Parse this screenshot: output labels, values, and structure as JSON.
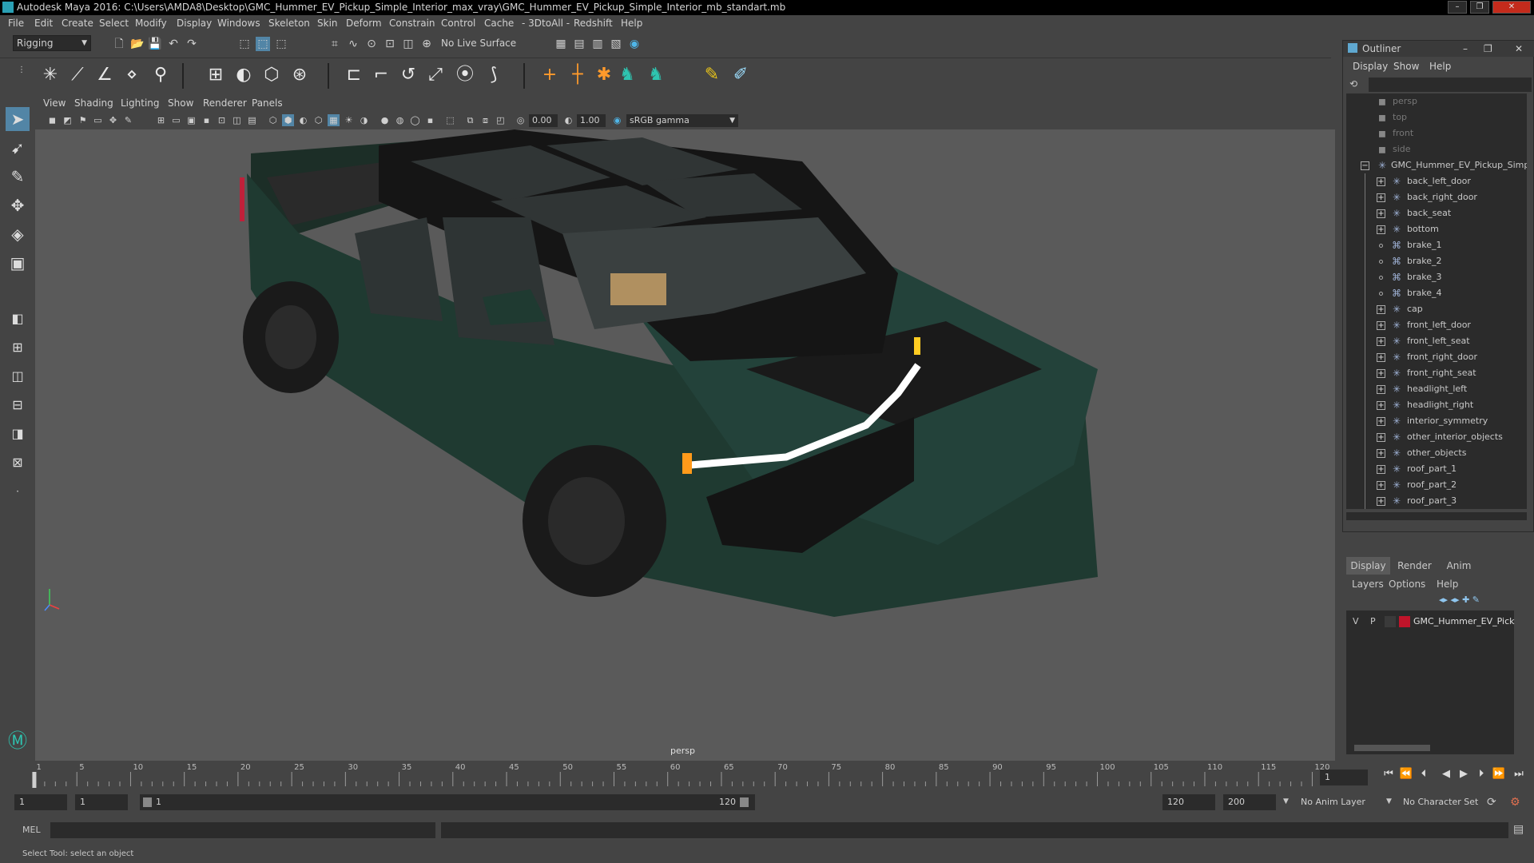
{
  "window": {
    "title": "Autodesk Maya 2016: C:\\Users\\AMDA8\\Desktop\\GMC_Hummer_EV_Pickup_Simple_Interior_max_vray\\GMC_Hummer_EV_Pickup_Simple_Interior_mb_standart.mb",
    "controls": [
      "–",
      "❐",
      "✕"
    ]
  },
  "menubar": [
    "File",
    "Edit",
    "Create",
    "Select",
    "Modify",
    "Display",
    "Windows",
    "Skeleton",
    "Skin",
    "Deform",
    "Constrain",
    "Control",
    "Cache",
    "- 3DtoAll -",
    "Redshift",
    "Help"
  ],
  "toolbar": {
    "menuset": "Rigging",
    "live_surface": "No Live Surface"
  },
  "viewport": {
    "menus": [
      "View",
      "Shading",
      "Lighting",
      "Show",
      "Renderer",
      "Panels"
    ],
    "exposure": "0.00",
    "gamma": "1.00",
    "color_space": "sRGB gamma",
    "camera_label": "persp"
  },
  "outliner": {
    "title": "Outliner",
    "menus": [
      "Display",
      "Show",
      "Help"
    ],
    "cameras": [
      "persp",
      "top",
      "front",
      "side"
    ],
    "root": "GMC_Hummer_EV_Pickup_Simp",
    "children": [
      {
        "name": "back_left_door",
        "kind": "group"
      },
      {
        "name": "back_right_door",
        "kind": "group"
      },
      {
        "name": "back_seat",
        "kind": "group"
      },
      {
        "name": "bottom",
        "kind": "group"
      },
      {
        "name": "brake_1",
        "kind": "mesh"
      },
      {
        "name": "brake_2",
        "kind": "mesh"
      },
      {
        "name": "brake_3",
        "kind": "mesh"
      },
      {
        "name": "brake_4",
        "kind": "mesh"
      },
      {
        "name": "cap",
        "kind": "group"
      },
      {
        "name": "front_left_door",
        "kind": "group"
      },
      {
        "name": "front_left_seat",
        "kind": "group"
      },
      {
        "name": "front_right_door",
        "kind": "group"
      },
      {
        "name": "front_right_seat",
        "kind": "group"
      },
      {
        "name": "headlight_left",
        "kind": "group"
      },
      {
        "name": "headlight_right",
        "kind": "group"
      },
      {
        "name": "interior_symmetry",
        "kind": "group"
      },
      {
        "name": "other_interior_objects",
        "kind": "group"
      },
      {
        "name": "other_objects",
        "kind": "group"
      },
      {
        "name": "roof_part_1",
        "kind": "group"
      },
      {
        "name": "roof_part_2",
        "kind": "group"
      },
      {
        "name": "roof_part_3",
        "kind": "group"
      }
    ]
  },
  "layer_editor": {
    "tabs": [
      "Display",
      "Render",
      "Anim"
    ],
    "menus": [
      "Layers",
      "Options",
      "Help"
    ],
    "layer": {
      "v": "V",
      "p": "P",
      "name": "GMC_Hummer_EV_Pick",
      "color": "#c0142a"
    }
  },
  "timeline": {
    "ticks": [
      "1",
      "5",
      "10",
      "15",
      "20",
      "25",
      "30",
      "35",
      "40",
      "45",
      "50",
      "55",
      "60",
      "65",
      "70",
      "75",
      "80",
      "85",
      "90",
      "95",
      "100",
      "105",
      "110",
      "115",
      "120"
    ],
    "current_frame": "1"
  },
  "range": {
    "start": "1",
    "start_inner": "1",
    "slider_start": "1",
    "slider_end": "120",
    "end": "120",
    "end_outer": "200",
    "anim_layer": "No Anim Layer",
    "character_set": "No Character Set"
  },
  "command": {
    "lang": "MEL"
  },
  "help_line": "Select Tool: select an object",
  "colors": {
    "accent_blue": "#5285a6",
    "truck_green": "#1f3a31",
    "layer_red": "#c0142a"
  }
}
